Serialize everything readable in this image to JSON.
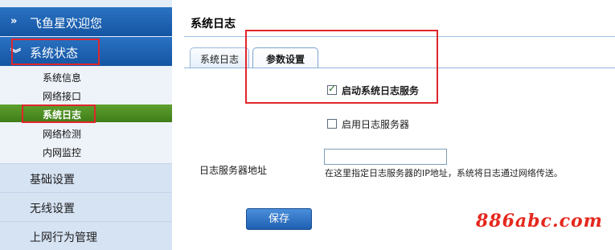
{
  "sidebar": {
    "welcome": "飞鱼星欢迎您",
    "status_section": "系统状态",
    "sub_items": [
      {
        "label": "系统信息"
      },
      {
        "label": "网络接口"
      },
      {
        "label": "系统日志"
      },
      {
        "label": "网络检测"
      },
      {
        "label": "内网监控"
      }
    ],
    "sections": [
      {
        "label": "基础设置"
      },
      {
        "label": "无线设置"
      },
      {
        "label": "上网行为管理"
      }
    ]
  },
  "main": {
    "title": "系统日志",
    "tabs": [
      {
        "label": "系统日志"
      },
      {
        "label": "参数设置"
      }
    ],
    "enable_log_label": "启动系统日志服务",
    "enable_log_checked": true,
    "enable_server_label": "启用日志服务器",
    "enable_server_checked": false,
    "server_addr_label": "日志服务器地址",
    "server_addr_value": "",
    "server_addr_hint": "在这里指定日志服务器的IP地址，系统将日志通过网络传送。",
    "save_label": "保存"
  },
  "watermark": "886abc.com",
  "colors": {
    "sidebar_header": "#1c62b3",
    "active_item": "#4f8f24",
    "highlight_box": "#e0262b",
    "button": "#2f73c6"
  }
}
